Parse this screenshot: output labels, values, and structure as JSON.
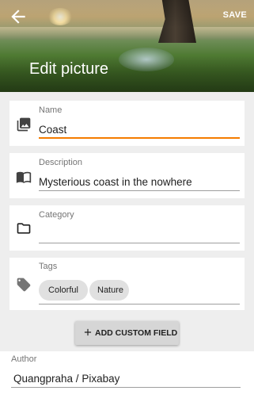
{
  "header": {
    "title": "Edit picture",
    "save_label": "SAVE",
    "back_icon": "arrow-back-icon"
  },
  "fields": {
    "name": {
      "label": "Name",
      "value": "Coast",
      "icon": "photo-library-icon"
    },
    "description": {
      "label": "Description",
      "value": "Mysterious coast in the nowhere",
      "icon": "book-icon"
    },
    "category": {
      "label": "Category",
      "value": "",
      "icon": "folder-icon"
    },
    "tags": {
      "label": "Tags",
      "icon": "tag-icon",
      "items": [
        "Colorful",
        "Nature"
      ]
    }
  },
  "add_custom_field": {
    "label": "ADD CUSTOM FIELD",
    "icon": "plus-icon"
  },
  "author": {
    "label": "Author",
    "value": "Quangpraha / Pixabay"
  },
  "colors": {
    "accent": "#f57c00",
    "background": "#eeeeee",
    "card": "#ffffff"
  }
}
